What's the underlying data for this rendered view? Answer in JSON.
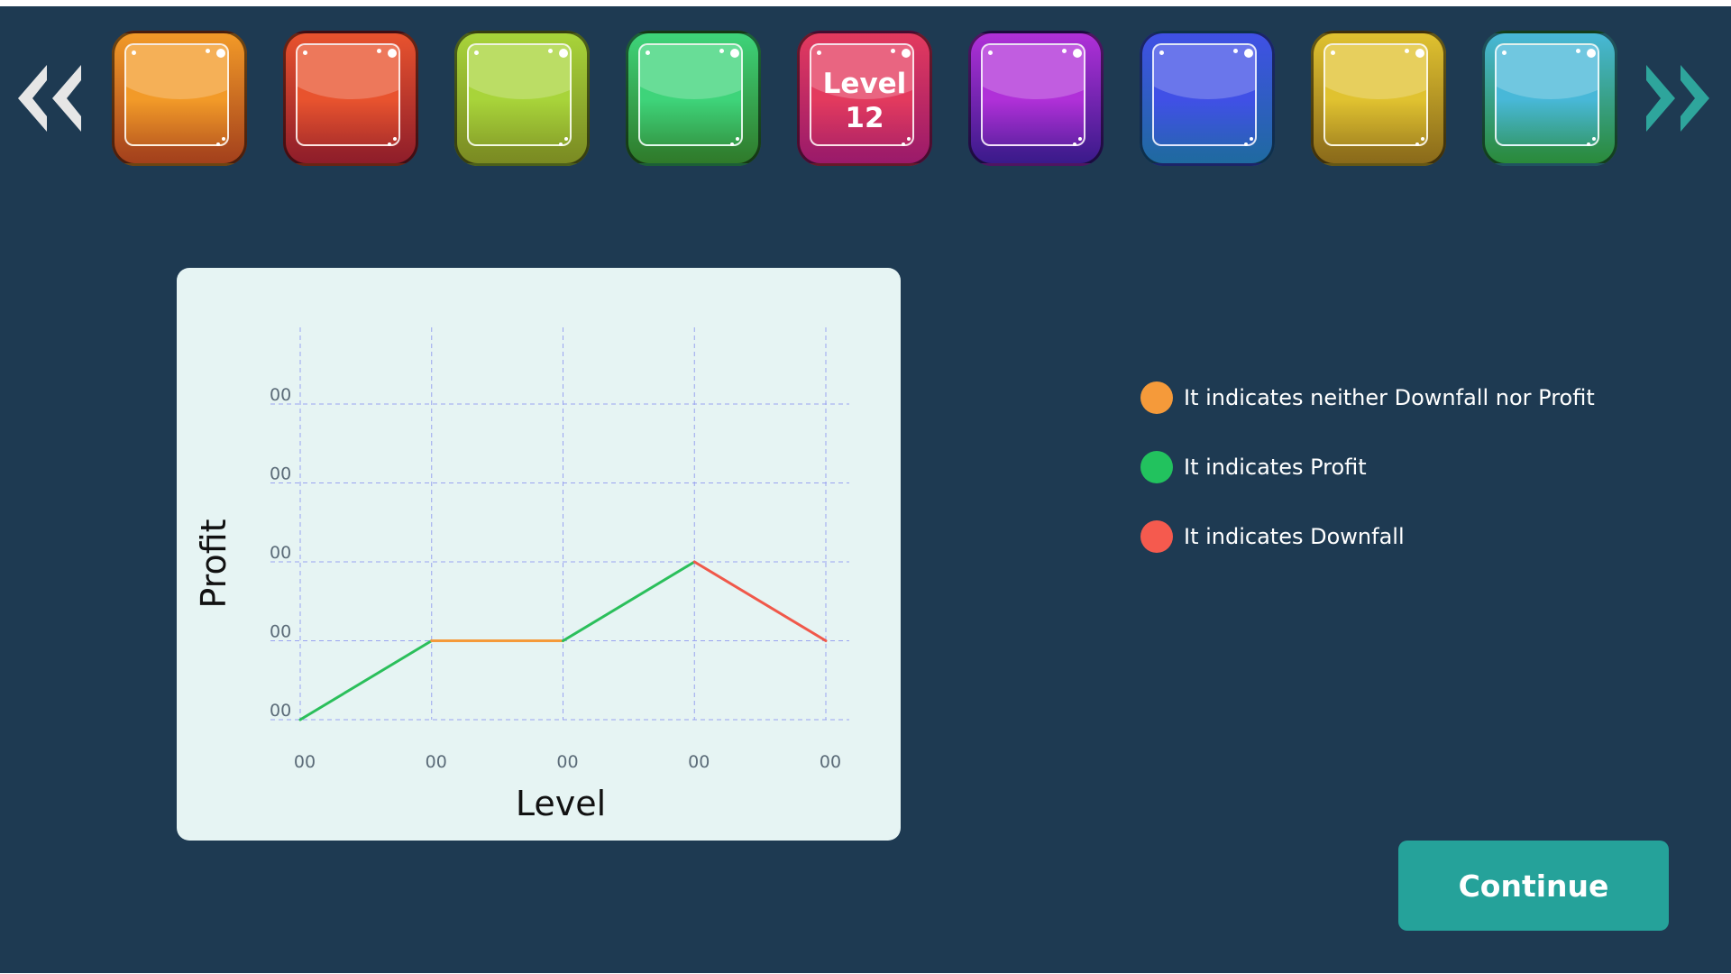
{
  "level_strip": {
    "prev_icon": "double-chevron-left-icon",
    "next_icon": "double-chevron-right-icon",
    "tiles": [
      {
        "color": "#f29a28",
        "frame": "#a3401c",
        "label_line1": "",
        "label_line2": ""
      },
      {
        "color": "#e8532e",
        "frame": "#8e1d2a",
        "label_line1": "",
        "label_line2": ""
      },
      {
        "color": "#a8d43a",
        "frame": "#7a8a22",
        "label_line1": "",
        "label_line2": ""
      },
      {
        "color": "#3ed47a",
        "frame": "#2f7a2a",
        "label_line1": "",
        "label_line2": ""
      },
      {
        "color": "#e33a5e",
        "frame": "#9a1a6a",
        "label_line1": "Level",
        "label_line2": "12"
      },
      {
        "color": "#b030d8",
        "frame": "#3a1a8a",
        "label_line1": "",
        "label_line2": ""
      },
      {
        "color": "#4050e6",
        "frame": "#1f6aa0",
        "label_line1": "",
        "label_line2": ""
      },
      {
        "color": "#e0c230",
        "frame": "#8a6a1a",
        "label_line1": "",
        "label_line2": ""
      },
      {
        "color": "#48b8d8",
        "frame": "#2a8a3a",
        "label_line1": "",
        "label_line2": ""
      }
    ]
  },
  "chart_data": {
    "type": "line",
    "title": "",
    "xlabel": "Level",
    "ylabel": "Profit",
    "x_tick_labels": [
      "00",
      "00",
      "00",
      "00",
      "00"
    ],
    "y_tick_labels": [
      "00",
      "00",
      "00",
      "00",
      "00"
    ],
    "x": [
      0,
      1,
      2,
      3,
      4
    ],
    "y": [
      0,
      1,
      1,
      2,
      1
    ],
    "ylim": [
      0,
      4
    ],
    "xlim": [
      0,
      4
    ],
    "grid": true,
    "segment_colors": [
      "#2bbf5b",
      "#f59a3a",
      "#2bbf5b",
      "#f0584a"
    ]
  },
  "legend": {
    "items": [
      {
        "color": "#f59a3a",
        "text": "It indicates neither Downfall nor Profit"
      },
      {
        "color": "#22c25e",
        "text": "It indicates Profit"
      },
      {
        "color": "#f55a4e",
        "text": "It indicates Downfall"
      }
    ]
  },
  "actions": {
    "continue_label": "Continue"
  },
  "theme": {
    "background": "#1e3a52",
    "card": "#e6f4f3",
    "accent": "#25a29a"
  }
}
